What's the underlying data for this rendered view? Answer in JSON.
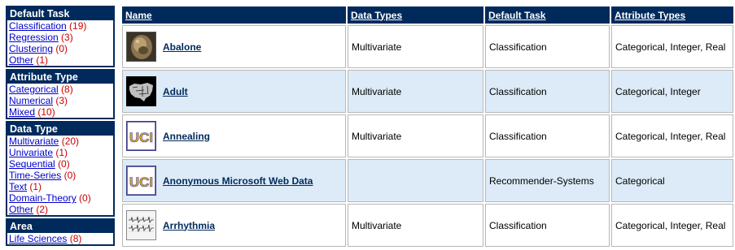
{
  "sidebar": {
    "default_task": {
      "title": "Default Task",
      "items": [
        {
          "label": "Classification",
          "count": "(19)"
        },
        {
          "label": "Regression",
          "count": "(3)"
        },
        {
          "label": "Clustering",
          "count": "(0)"
        },
        {
          "label": "Other",
          "count": "(1)"
        }
      ]
    },
    "attribute_type": {
      "title": "Attribute Type",
      "items": [
        {
          "label": "Categorical",
          "count": "(8)"
        },
        {
          "label": "Numerical",
          "count": "(3)"
        },
        {
          "label": "Mixed",
          "count": "(10)"
        }
      ]
    },
    "data_type": {
      "title": "Data Type",
      "items": [
        {
          "label": "Multivariate",
          "count": "(20)"
        },
        {
          "label": "Univariate",
          "count": "(1)"
        },
        {
          "label": "Sequential",
          "count": "(0)"
        },
        {
          "label": "Time-Series",
          "count": "(0)"
        },
        {
          "label": "Text",
          "count": "(1)"
        },
        {
          "label": "Domain-Theory",
          "count": "(0)"
        },
        {
          "label": "Other",
          "count": "(2)"
        }
      ]
    },
    "area": {
      "title": "Area",
      "items": [
        {
          "label": "Life Sciences",
          "count": "(8)"
        }
      ]
    }
  },
  "table": {
    "headers": [
      "Name",
      "Data Types",
      "Default Task",
      "Attribute Types"
    ],
    "rows": [
      {
        "name": "Abalone",
        "data_types": "Multivariate",
        "default_task": "Classification",
        "attribute_types": "Categorical, Integer, Real",
        "thumb_icon": "abalone-photo-icon"
      },
      {
        "name": "Adult",
        "data_types": "Multivariate",
        "default_task": "Classification",
        "attribute_types": "Categorical, Integer",
        "thumb_icon": "us-map-icon"
      },
      {
        "name": "Annealing",
        "data_types": "Multivariate",
        "default_task": "Classification",
        "attribute_types": "Categorical, Integer, Real",
        "thumb_icon": "uci-logo-icon",
        "thumb_text": "UCI"
      },
      {
        "name": "Anonymous Microsoft Web Data",
        "data_types": "",
        "default_task": "Recommender-Systems",
        "attribute_types": "Categorical",
        "thumb_icon": "uci-logo-icon",
        "thumb_text": "UCI"
      },
      {
        "name": "Arrhythmia",
        "data_types": "Multivariate",
        "default_task": "Classification",
        "attribute_types": "Categorical, Integer, Real",
        "thumb_icon": "ecg-chart-icon"
      }
    ]
  },
  "colors": {
    "header_bg": "#002a5c",
    "alt_row_bg": "#dcebf7",
    "link": "#0000cc",
    "count": "#cc0000",
    "uci_gold": "#e6a817"
  }
}
